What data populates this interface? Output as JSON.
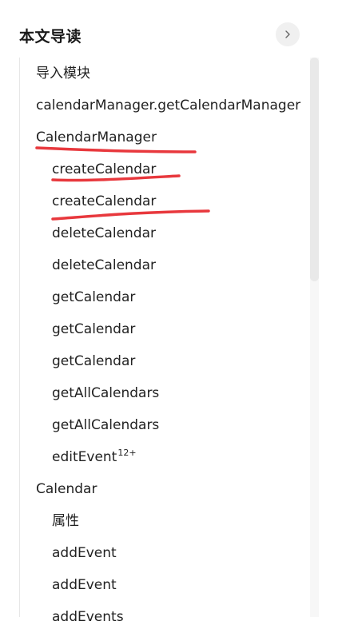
{
  "header": {
    "title": "本文导读",
    "collapse_icon": "chevron-right-icon"
  },
  "toc": {
    "items": [
      {
        "label": "导入模块",
        "level": 1
      },
      {
        "label": "calendarManager.getCalendarManager",
        "level": 1
      },
      {
        "label": "CalendarManager",
        "level": 1
      },
      {
        "label": "createCalendar",
        "level": 2
      },
      {
        "label": "createCalendar",
        "level": 2
      },
      {
        "label": "deleteCalendar",
        "level": 2
      },
      {
        "label": "deleteCalendar",
        "level": 2
      },
      {
        "label": "getCalendar",
        "level": 2
      },
      {
        "label": "getCalendar",
        "level": 2
      },
      {
        "label": "getCalendar",
        "level": 2
      },
      {
        "label": "getAllCalendars",
        "level": 2
      },
      {
        "label": "getAllCalendars",
        "level": 2
      },
      {
        "label": "editEvent",
        "level": 2,
        "superscript": "12+"
      },
      {
        "label": "Calendar",
        "level": 1
      },
      {
        "label": "属性",
        "level": 2
      },
      {
        "label": "addEvent",
        "level": 2
      },
      {
        "label": "addEvent",
        "level": 2
      },
      {
        "label": "addEvents",
        "level": 2
      }
    ]
  },
  "annotation_color": "#e8383d"
}
